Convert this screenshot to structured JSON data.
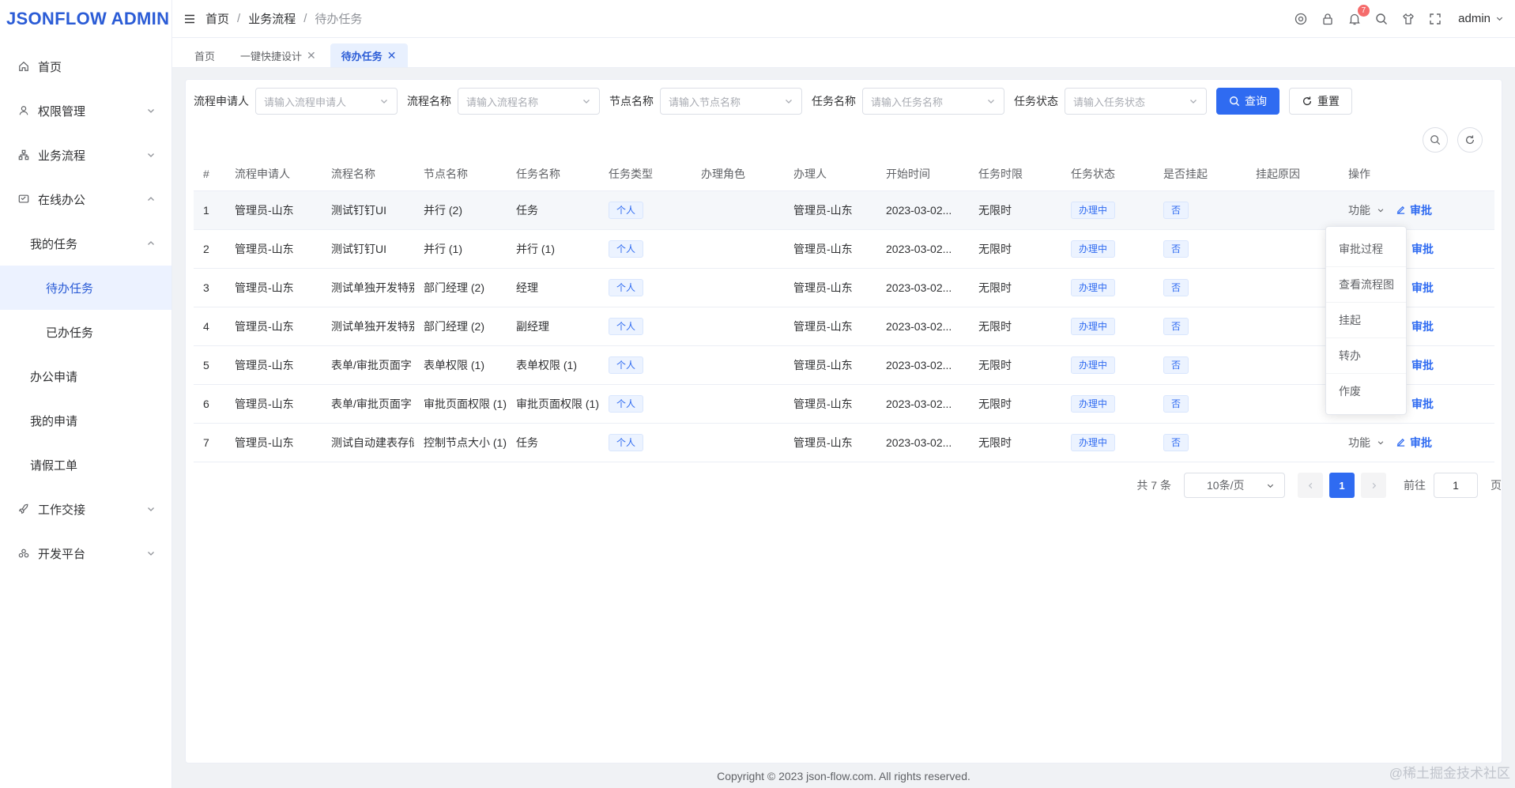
{
  "app": {
    "logo": "JSONFLOW ADMIN"
  },
  "sidebar": {
    "items": [
      {
        "label": "首页"
      },
      {
        "label": "权限管理"
      },
      {
        "label": "业务流程"
      },
      {
        "label": "在线办公"
      },
      {
        "label": "我的任务"
      },
      {
        "label": "待办任务"
      },
      {
        "label": "已办任务"
      },
      {
        "label": "办公申请"
      },
      {
        "label": "我的申请"
      },
      {
        "label": "请假工单"
      },
      {
        "label": "工作交接"
      },
      {
        "label": "开发平台"
      }
    ]
  },
  "header": {
    "breadcrumb": [
      "首页",
      "业务流程",
      "待办任务"
    ],
    "separator": "/",
    "notification_count": "7",
    "user": "admin"
  },
  "tabs": [
    {
      "label": "首页"
    },
    {
      "label": "一键快捷设计",
      "close": "✕"
    },
    {
      "label": "待办任务",
      "close": "✕"
    }
  ],
  "filters": {
    "applicant": {
      "label": "流程申请人",
      "placeholder": "请输入流程申请人"
    },
    "flow_name": {
      "label": "流程名称",
      "placeholder": "请输入流程名称"
    },
    "node_name": {
      "label": "节点名称",
      "placeholder": "请输入节点名称"
    },
    "task_name": {
      "label": "任务名称",
      "placeholder": "请输入任务名称"
    },
    "task_status": {
      "label": "任务状态",
      "placeholder": "请输入任务状态"
    },
    "search_label": "查询",
    "reset_label": "重置"
  },
  "table": {
    "columns": [
      "#",
      "流程申请人",
      "流程名称",
      "节点名称",
      "任务名称",
      "任务类型",
      "办理角色",
      "办理人",
      "开始时间",
      "任务时限",
      "任务状态",
      "是否挂起",
      "挂起原因",
      "操作"
    ],
    "rows": [
      {
        "no": "1",
        "applicant": "管理员-山东",
        "flow": "测试钉钉UI",
        "node": "并行 (2)",
        "task": "任务",
        "type": "个人",
        "role": "",
        "handler": "管理员-山东",
        "start": "2023-03-02...",
        "limit": "无限时",
        "status": "办理中",
        "suspended": "否",
        "reason": "",
        "func": "功能",
        "approve": "审批"
      },
      {
        "no": "2",
        "applicant": "管理员-山东",
        "flow": "测试钉钉UI",
        "node": "并行 (1)",
        "task": "并行 (1)",
        "type": "个人",
        "role": "",
        "handler": "管理员-山东",
        "start": "2023-03-02...",
        "limit": "无限时",
        "status": "办理中",
        "suspended": "否",
        "reason": "",
        "func": "",
        "approve": "审批"
      },
      {
        "no": "3",
        "applicant": "管理员-山东",
        "flow": "测试单独开发特别",
        "node": "部门经理 (2)",
        "task": "经理",
        "type": "个人",
        "role": "",
        "handler": "管理员-山东",
        "start": "2023-03-02...",
        "limit": "无限时",
        "status": "办理中",
        "suspended": "否",
        "reason": "",
        "func": "",
        "approve": "审批"
      },
      {
        "no": "4",
        "applicant": "管理员-山东",
        "flow": "测试单独开发特别",
        "node": "部门经理 (2)",
        "task": "副经理",
        "type": "个人",
        "role": "",
        "handler": "管理员-山东",
        "start": "2023-03-02...",
        "limit": "无限时",
        "status": "办理中",
        "suspended": "否",
        "reason": "",
        "func": "",
        "approve": "审批"
      },
      {
        "no": "5",
        "applicant": "管理员-山东",
        "flow": "表单/审批页面字",
        "node": "表单权限 (1)",
        "task": "表单权限 (1)",
        "type": "个人",
        "role": "",
        "handler": "管理员-山东",
        "start": "2023-03-02...",
        "limit": "无限时",
        "status": "办理中",
        "suspended": "否",
        "reason": "",
        "func": "",
        "approve": "审批"
      },
      {
        "no": "6",
        "applicant": "管理员-山东",
        "flow": "表单/审批页面字",
        "node": "审批页面权限 (1)",
        "task": "审批页面权限 (1)",
        "type": "个人",
        "role": "",
        "handler": "管理员-山东",
        "start": "2023-03-02...",
        "limit": "无限时",
        "status": "办理中",
        "suspended": "否",
        "reason": "",
        "func": "",
        "approve": "审批"
      },
      {
        "no": "7",
        "applicant": "管理员-山东",
        "flow": "测试自动建表存储",
        "node": "控制节点大小 (1)",
        "task": "任务",
        "type": "个人",
        "role": "",
        "handler": "管理员-山东",
        "start": "2023-03-02...",
        "limit": "无限时",
        "status": "办理中",
        "suspended": "否",
        "reason": "",
        "func": "功能",
        "approve": "审批"
      }
    ]
  },
  "dropdown": {
    "items": [
      "审批过程",
      "查看流程图",
      "挂起",
      "转办",
      "作废"
    ]
  },
  "pagination": {
    "total": "共 7 条",
    "page_size": "10条/页",
    "current_page": "1",
    "jump_label": "前往",
    "jump_value": "1",
    "jump_suffix": "页"
  },
  "footer": {
    "copyright": "Copyright © 2023 json-flow.com. All rights reserved.",
    "credit": "@稀土掘金技术社区"
  },
  "colors": {
    "primary": "#2f6bf1",
    "logo": "#2b5cd6",
    "badge": "#f56c6c"
  }
}
